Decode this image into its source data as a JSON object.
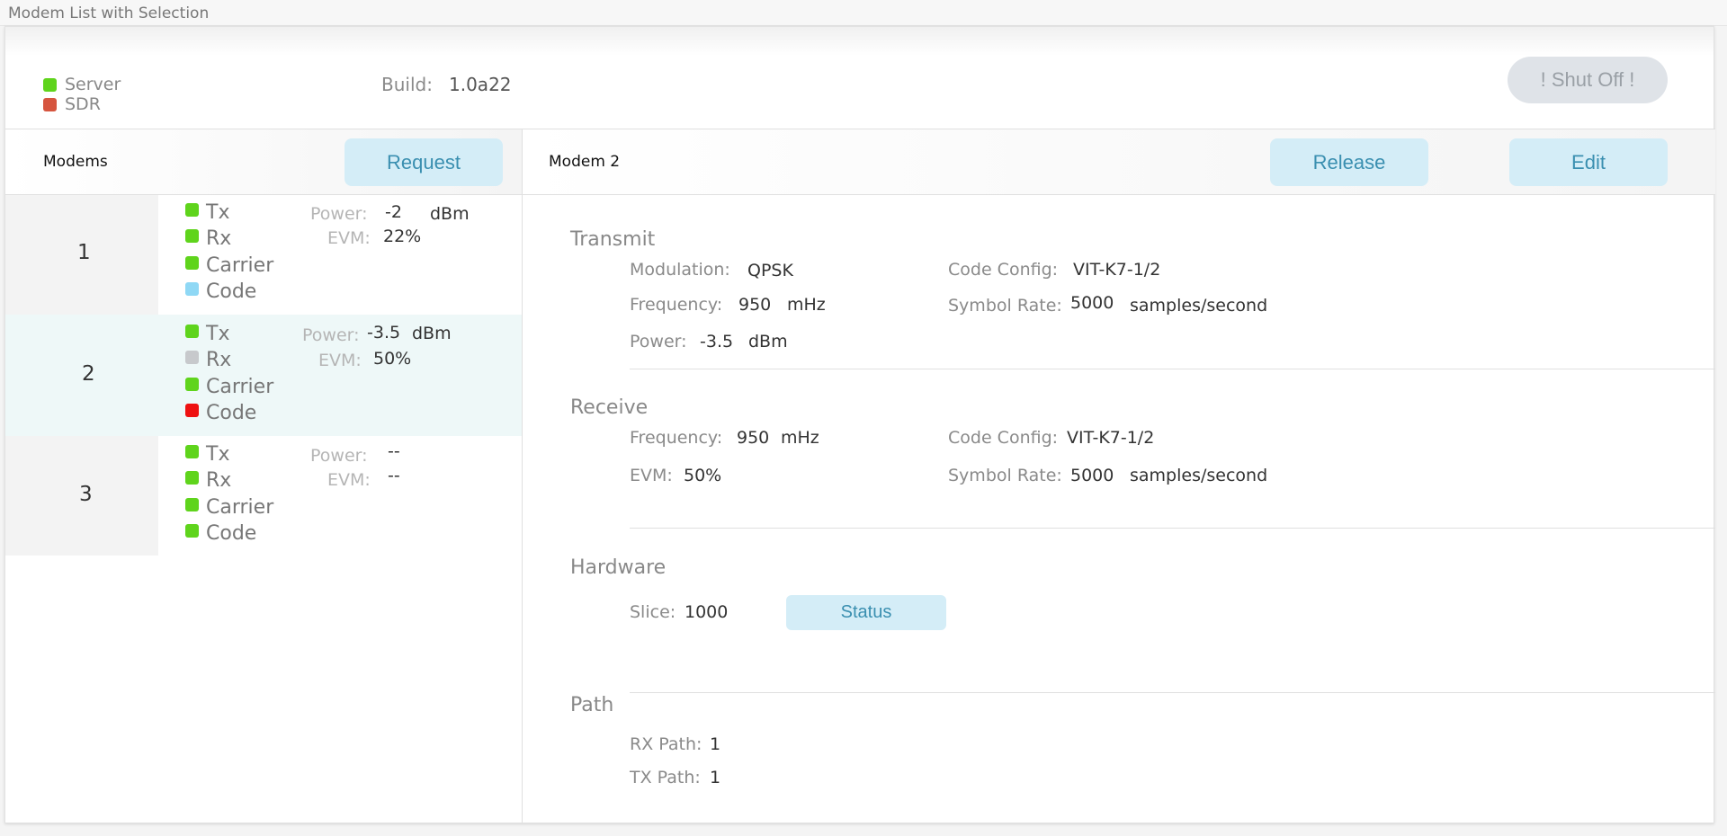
{
  "window": {
    "title": "Modem List with Selection"
  },
  "header": {
    "indicators": [
      {
        "label": "Server",
        "color": "#5fd41c"
      },
      {
        "label": "SDR",
        "color": "#d6553f"
      }
    ],
    "build_label": "Build:",
    "build_value": "1.0a22",
    "shutoff_label": "! Shut Off !"
  },
  "modems_panel": {
    "title": "Modems",
    "request_label": "Request",
    "power_label": "Power:",
    "evm_label": "EVM:",
    "rows": [
      {
        "number": "1",
        "selected": false,
        "signals": [
          {
            "label": "Tx",
            "color": "#5fd41c"
          },
          {
            "label": "Rx",
            "color": "#5fd41c"
          },
          {
            "label": "Carrier",
            "color": "#5fd41c"
          },
          {
            "label": "Code",
            "color": "#8fd8f5"
          }
        ],
        "power": "-2",
        "power_unit": "dBm",
        "evm": "22%"
      },
      {
        "number": "2",
        "selected": true,
        "signals": [
          {
            "label": "Tx",
            "color": "#5fd41c"
          },
          {
            "label": "Rx",
            "color": "#c7c9cc"
          },
          {
            "label": "Carrier",
            "color": "#5fd41c"
          },
          {
            "label": "Code",
            "color": "#ee1111"
          }
        ],
        "power": "-3.5",
        "power_unit": "dBm",
        "evm": "50%"
      },
      {
        "number": "3",
        "selected": false,
        "signals": [
          {
            "label": "Tx",
            "color": "#5fd41c"
          },
          {
            "label": "Rx",
            "color": "#5fd41c"
          },
          {
            "label": "Carrier",
            "color": "#5fd41c"
          },
          {
            "label": "Code",
            "color": "#5fd41c"
          }
        ],
        "power": "--",
        "power_unit": "",
        "evm": "--"
      }
    ]
  },
  "detail": {
    "title": "Modem 2",
    "release_label": "Release",
    "edit_label": "Edit",
    "transmit": {
      "title": "Transmit",
      "modulation_label": "Modulation:",
      "modulation": "QPSK",
      "frequency_label": "Frequency:",
      "frequency": "950",
      "frequency_unit": "mHz",
      "power_label": "Power:",
      "power": "-3.5",
      "power_unit": "dBm",
      "code_config_label": "Code Config:",
      "code_config": "VIT-K7-1/2",
      "symbol_rate_label": "Symbol Rate:",
      "symbol_rate": "5000",
      "symbol_rate_unit": "samples/second"
    },
    "receive": {
      "title": "Receive",
      "frequency_label": "Frequency:",
      "frequency": "950",
      "frequency_unit": "mHz",
      "evm_label": "EVM:",
      "evm": "50%",
      "code_config_label": "Code Config:",
      "code_config": "VIT-K7-1/2",
      "symbol_rate_label": "Symbol Rate:",
      "symbol_rate": "5000",
      "symbol_rate_unit": "samples/second"
    },
    "hardware": {
      "title": "Hardware",
      "slice_label": "Slice:",
      "slice": "1000",
      "status_label": "Status"
    },
    "path": {
      "title": "Path",
      "rx_label": "RX Path:",
      "rx": "1",
      "tx_label": "TX Path:",
      "tx": "1"
    }
  }
}
